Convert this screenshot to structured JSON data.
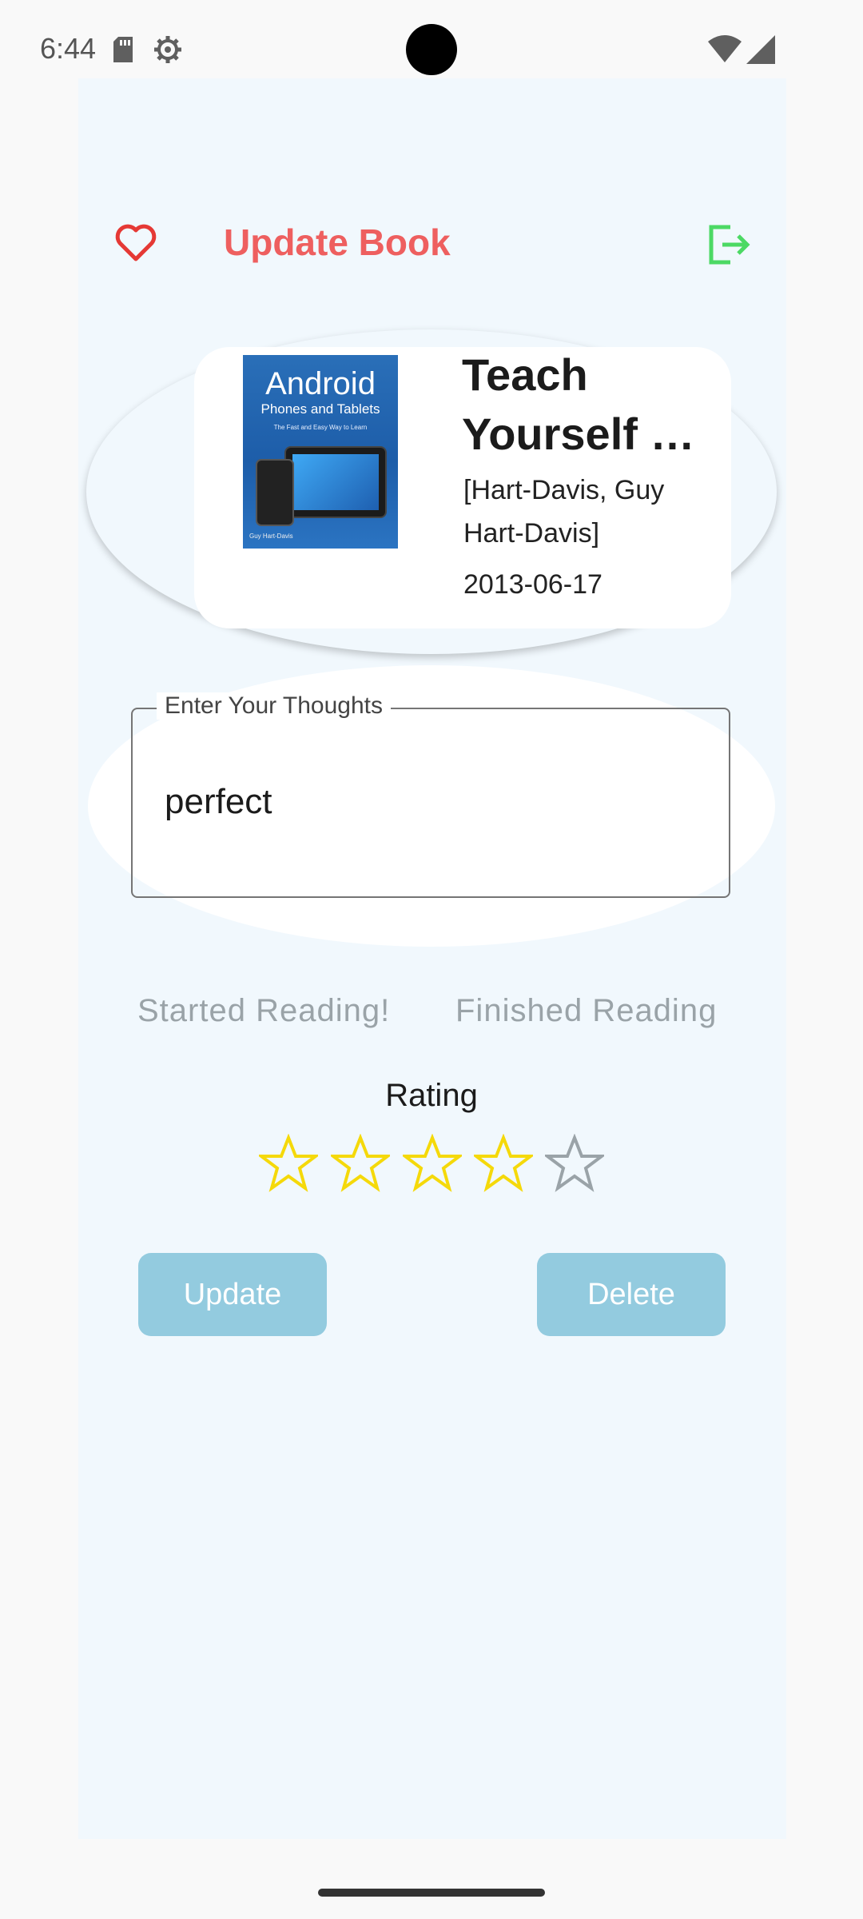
{
  "status_bar": {
    "time": "6:44",
    "icons": [
      "sd-card-icon",
      "settings-gear-icon",
      "wifi-icon",
      "cellular-signal-icon"
    ]
  },
  "header": {
    "title": "Update Book",
    "left_icon": "heart-icon",
    "right_icon": "logout-icon"
  },
  "book": {
    "title_line1": "Teach",
    "title_line2": "Yourself Visually Android Phones and Tablets",
    "authors": "[Hart-Davis, Guy Hart-Davis]",
    "published_date": "2013-06-17",
    "cover": {
      "brand": "Android",
      "subtitle": "Phones and Tablets",
      "tagline": "The Fast and Easy Way to Learn",
      "author": "Guy Hart-Davis"
    }
  },
  "thoughts": {
    "label": "Enter Your Thoughts",
    "value": "perfect"
  },
  "reading": {
    "started_label": "Started Reading!",
    "finished_label": "Finished Reading"
  },
  "rating": {
    "label": "Rating",
    "value": 4,
    "max": 5
  },
  "actions": {
    "update_label": "Update",
    "delete_label": "Delete"
  },
  "colors": {
    "accent_red": "#ee5f5f",
    "logout_green": "#4cd964",
    "star_filled": "#f5d90a",
    "star_empty": "#9aa3a8",
    "button_bg": "#93cbdf",
    "app_bg": "#f1f8fd"
  }
}
